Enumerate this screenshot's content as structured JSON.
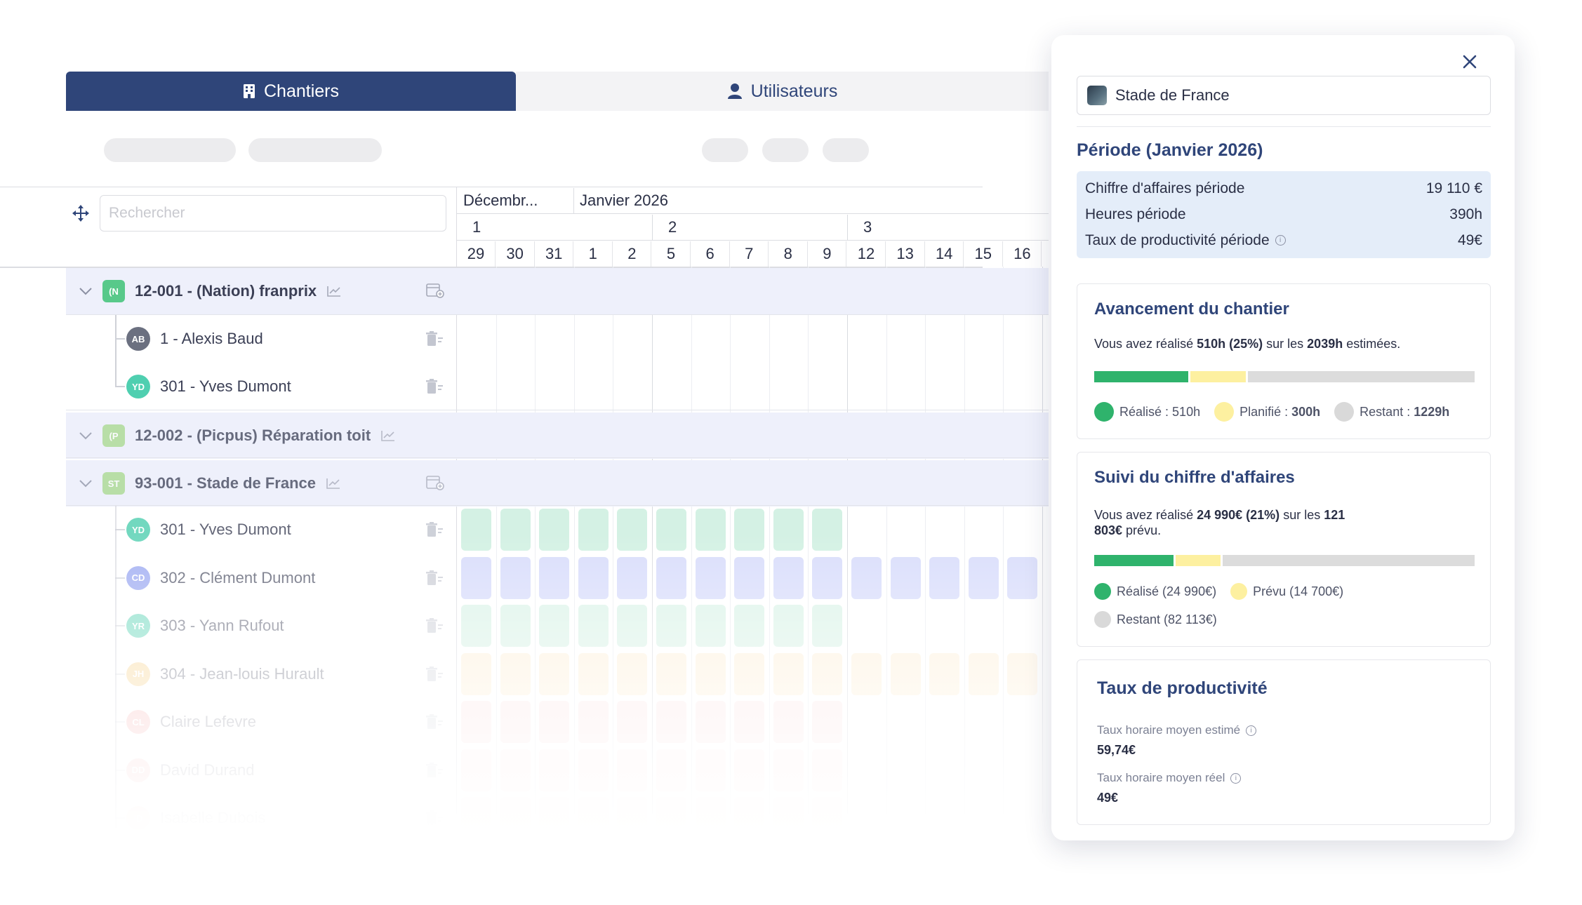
{
  "tabs": [
    {
      "label": "Chantiers",
      "active": true
    },
    {
      "label": "Utilisateurs",
      "active": false
    }
  ],
  "search": {
    "placeholder": "Rechercher"
  },
  "calendar": {
    "months": [
      "Décembr...",
      "Janvier 2026"
    ],
    "weeks": [
      "1",
      "2",
      "3"
    ],
    "days": [
      "29",
      "30",
      "31",
      "1",
      "2",
      "5",
      "6",
      "7",
      "8",
      "9",
      "12",
      "13",
      "14",
      "15",
      "16"
    ]
  },
  "projects": [
    {
      "badge": "(N",
      "label": "12-001 - (Nation) franprix",
      "badge_color": "#58c98a"
    },
    {
      "badge": "(P",
      "label": "12-002 - (Picpus) Réparation toit",
      "badge_color": "#a6d98b"
    },
    {
      "badge": "ST",
      "label": "93-001 - Stade de France",
      "badge_color": "#a6d98b"
    }
  ],
  "members_nation": [
    {
      "initials": "AB",
      "label": "1 - Alexis Baud",
      "color": "#6b7080"
    },
    {
      "initials": "YD",
      "label": "301 - Yves Dumont",
      "color": "#4fcfb0"
    }
  ],
  "members_stade": [
    {
      "initials": "YD",
      "label": "301 - Yves Dumont",
      "color": "#4fcfb0",
      "cell_color": "#c9eedd",
      "days": 10
    },
    {
      "initials": "CD",
      "label": "302 - Clément Dumont",
      "color": "#8c9bf0",
      "cell_color": "#cdd3fa",
      "days": 15
    },
    {
      "initials": "YR",
      "label": "303 - Yann Rufout",
      "color": "#4fcfb0",
      "cell_color": "#c9eedd",
      "days": 10
    },
    {
      "initials": "JH",
      "label": "304 - Jean-louis Hurault",
      "color": "#f5c46a",
      "cell_color": "#fde7c4",
      "days": 15
    },
    {
      "initials": "CL",
      "label": "Claire Lefevre",
      "color": "#f58a8a",
      "cell_color": "#fbd3d3",
      "days": 10
    },
    {
      "initials": "DD",
      "label": "David Durand",
      "color": "#f58a8a",
      "cell_color": "#fbd3d3",
      "days": 10
    },
    {
      "initials": "ID",
      "label": "Isabelle Dubois",
      "color": "#f5a07a",
      "cell_color": "#fbdcc9",
      "days": 10
    }
  ],
  "panel": {
    "project": "Stade de France",
    "period_title": "Période (Janvier 2026)",
    "period_rows": [
      {
        "label": "Chiffre d'affaires période",
        "value": "19 110 €"
      },
      {
        "label": "Heures période",
        "value": "390h"
      },
      {
        "label": "Taux de productivité période",
        "value": "49€"
      }
    ],
    "progress": {
      "title": "Avancement du chantier",
      "text_pre": "Vous avez réalisé ",
      "text_b1": "510h (25%)",
      "text_mid": " sur les ",
      "text_b2": "2039h",
      "text_post": " estimées.",
      "done_fraction": 0.25,
      "planned_fraction": 0.147,
      "legend": [
        {
          "label": "Réalisé : ",
          "value": "510h",
          "color": "#2fb36c"
        },
        {
          "label": "Planifié : ",
          "value": "300h",
          "color": "#fdf0a0"
        },
        {
          "label": "Restant : ",
          "value": "1229h",
          "color": "#d9d9d9"
        }
      ]
    },
    "revenue": {
      "title": "Suivi du chiffre d'affaires",
      "text_pre": "Vous avez réalisé ",
      "text_b1": "24 990€ (21%)",
      "text_mid": " sur les ",
      "text_b2": "121",
      "text_b3": "803€",
      "text_post": " prévu.",
      "done_fraction": 0.21,
      "planned_fraction": 0.12,
      "legend": [
        {
          "label": "Réalisé (24 990€)",
          "color": "#2fb36c"
        },
        {
          "label": "Prévu (14 700€)",
          "color": "#fdf0a0"
        },
        {
          "label": "Restant (82 113€)",
          "color": "#d9d9d9"
        }
      ]
    },
    "productivity": {
      "title": "Taux de productivité",
      "estimated_label": "Taux horaire moyen estimé",
      "estimated_value": "59,74€",
      "real_label": "Taux horaire moyen réel",
      "real_value": "49€"
    }
  }
}
